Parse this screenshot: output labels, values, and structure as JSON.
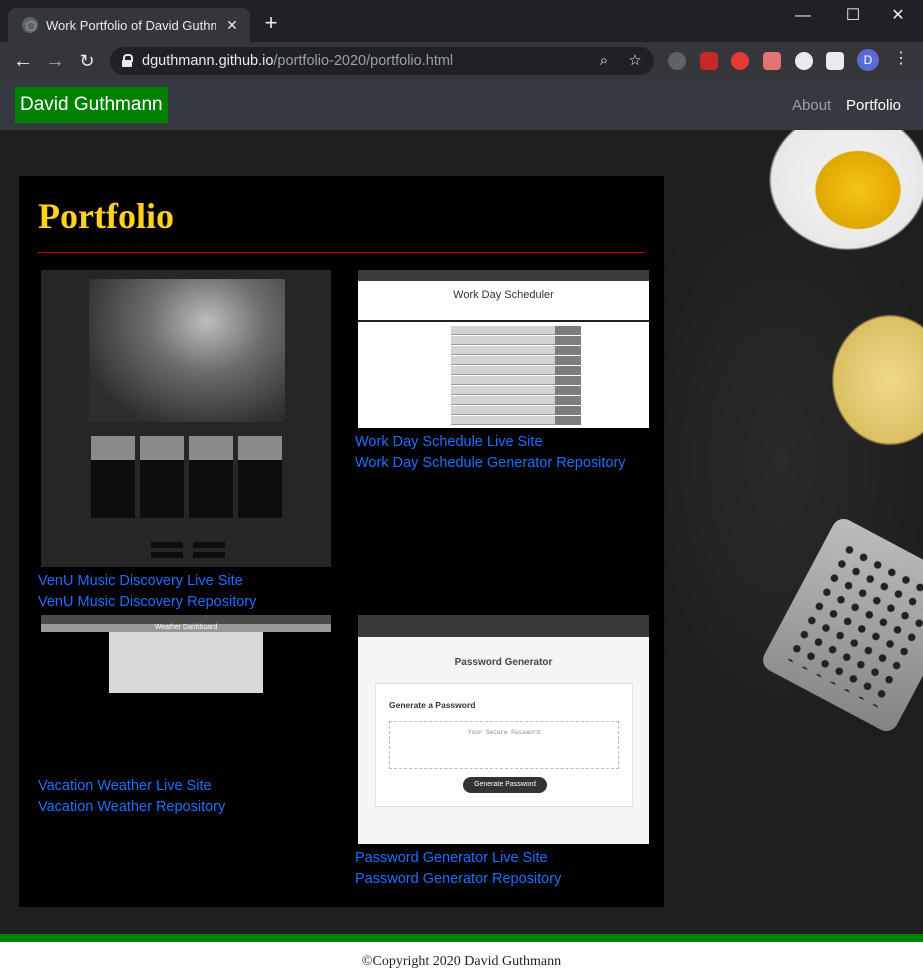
{
  "browser": {
    "tab_title": "Work Portfolio of David Guthmann",
    "url_host": "dguthmann.github.io",
    "url_path": "/portfolio-2020/portfolio.html",
    "profile_initial": "D"
  },
  "navbar": {
    "brand": "David Guthmann",
    "links": [
      "About",
      "Portfolio"
    ]
  },
  "portfolio": {
    "title": "Portfolio",
    "projects": [
      {
        "live_label": "VenU Music Discovery Live Site",
        "repo_label": "VenU Music Discovery Repository"
      },
      {
        "shot_title": "Work Day Scheduler",
        "live_label": "Work Day Schedule Live Site",
        "repo_label": "Work Day Schedule Generator Repository"
      },
      {
        "shot_title": "Weather Dashboard",
        "live_label": "Vacation Weather Live Site",
        "repo_label": "Vacation Weather Repository"
      },
      {
        "shot_title": "Password Generator",
        "shot_card_heading": "Generate a Password",
        "shot_placeholder": "Your Secure Password",
        "shot_button": "Generate Password",
        "live_label": "Password Generator Live Site",
        "repo_label": "Password Generator Repository"
      }
    ]
  },
  "footer": {
    "copyright": "©Copyright 2020 David Guthmann"
  }
}
